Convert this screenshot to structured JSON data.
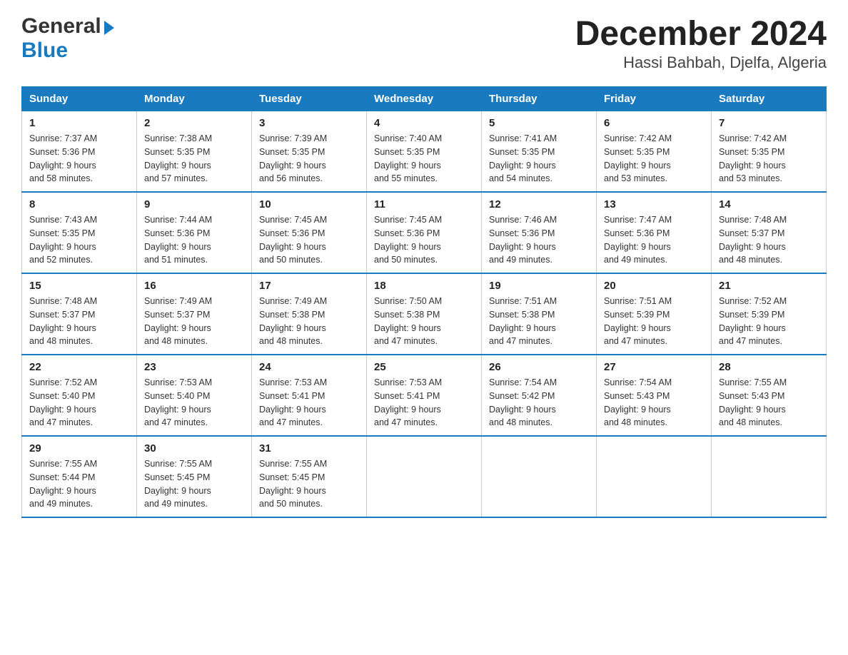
{
  "logo": {
    "line1": "General",
    "triangle": "▶",
    "line2": "Blue"
  },
  "title": "December 2024",
  "subtitle": "Hassi Bahbah, Djelfa, Algeria",
  "days_of_week": [
    "Sunday",
    "Monday",
    "Tuesday",
    "Wednesday",
    "Thursday",
    "Friday",
    "Saturday"
  ],
  "weeks": [
    [
      {
        "day": "1",
        "sunrise": "7:37 AM",
        "sunset": "5:36 PM",
        "daylight": "9 hours and 58 minutes."
      },
      {
        "day": "2",
        "sunrise": "7:38 AM",
        "sunset": "5:35 PM",
        "daylight": "9 hours and 57 minutes."
      },
      {
        "day": "3",
        "sunrise": "7:39 AM",
        "sunset": "5:35 PM",
        "daylight": "9 hours and 56 minutes."
      },
      {
        "day": "4",
        "sunrise": "7:40 AM",
        "sunset": "5:35 PM",
        "daylight": "9 hours and 55 minutes."
      },
      {
        "day": "5",
        "sunrise": "7:41 AM",
        "sunset": "5:35 PM",
        "daylight": "9 hours and 54 minutes."
      },
      {
        "day": "6",
        "sunrise": "7:42 AM",
        "sunset": "5:35 PM",
        "daylight": "9 hours and 53 minutes."
      },
      {
        "day": "7",
        "sunrise": "7:42 AM",
        "sunset": "5:35 PM",
        "daylight": "9 hours and 53 minutes."
      }
    ],
    [
      {
        "day": "8",
        "sunrise": "7:43 AM",
        "sunset": "5:35 PM",
        "daylight": "9 hours and 52 minutes."
      },
      {
        "day": "9",
        "sunrise": "7:44 AM",
        "sunset": "5:36 PM",
        "daylight": "9 hours and 51 minutes."
      },
      {
        "day": "10",
        "sunrise": "7:45 AM",
        "sunset": "5:36 PM",
        "daylight": "9 hours and 50 minutes."
      },
      {
        "day": "11",
        "sunrise": "7:45 AM",
        "sunset": "5:36 PM",
        "daylight": "9 hours and 50 minutes."
      },
      {
        "day": "12",
        "sunrise": "7:46 AM",
        "sunset": "5:36 PM",
        "daylight": "9 hours and 49 minutes."
      },
      {
        "day": "13",
        "sunrise": "7:47 AM",
        "sunset": "5:36 PM",
        "daylight": "9 hours and 49 minutes."
      },
      {
        "day": "14",
        "sunrise": "7:48 AM",
        "sunset": "5:37 PM",
        "daylight": "9 hours and 48 minutes."
      }
    ],
    [
      {
        "day": "15",
        "sunrise": "7:48 AM",
        "sunset": "5:37 PM",
        "daylight": "9 hours and 48 minutes."
      },
      {
        "day": "16",
        "sunrise": "7:49 AM",
        "sunset": "5:37 PM",
        "daylight": "9 hours and 48 minutes."
      },
      {
        "day": "17",
        "sunrise": "7:49 AM",
        "sunset": "5:38 PM",
        "daylight": "9 hours and 48 minutes."
      },
      {
        "day": "18",
        "sunrise": "7:50 AM",
        "sunset": "5:38 PM",
        "daylight": "9 hours and 47 minutes."
      },
      {
        "day": "19",
        "sunrise": "7:51 AM",
        "sunset": "5:38 PM",
        "daylight": "9 hours and 47 minutes."
      },
      {
        "day": "20",
        "sunrise": "7:51 AM",
        "sunset": "5:39 PM",
        "daylight": "9 hours and 47 minutes."
      },
      {
        "day": "21",
        "sunrise": "7:52 AM",
        "sunset": "5:39 PM",
        "daylight": "9 hours and 47 minutes."
      }
    ],
    [
      {
        "day": "22",
        "sunrise": "7:52 AM",
        "sunset": "5:40 PM",
        "daylight": "9 hours and 47 minutes."
      },
      {
        "day": "23",
        "sunrise": "7:53 AM",
        "sunset": "5:40 PM",
        "daylight": "9 hours and 47 minutes."
      },
      {
        "day": "24",
        "sunrise": "7:53 AM",
        "sunset": "5:41 PM",
        "daylight": "9 hours and 47 minutes."
      },
      {
        "day": "25",
        "sunrise": "7:53 AM",
        "sunset": "5:41 PM",
        "daylight": "9 hours and 47 minutes."
      },
      {
        "day": "26",
        "sunrise": "7:54 AM",
        "sunset": "5:42 PM",
        "daylight": "9 hours and 48 minutes."
      },
      {
        "day": "27",
        "sunrise": "7:54 AM",
        "sunset": "5:43 PM",
        "daylight": "9 hours and 48 minutes."
      },
      {
        "day": "28",
        "sunrise": "7:55 AM",
        "sunset": "5:43 PM",
        "daylight": "9 hours and 48 minutes."
      }
    ],
    [
      {
        "day": "29",
        "sunrise": "7:55 AM",
        "sunset": "5:44 PM",
        "daylight": "9 hours and 49 minutes."
      },
      {
        "day": "30",
        "sunrise": "7:55 AM",
        "sunset": "5:45 PM",
        "daylight": "9 hours and 49 minutes."
      },
      {
        "day": "31",
        "sunrise": "7:55 AM",
        "sunset": "5:45 PM",
        "daylight": "9 hours and 50 minutes."
      },
      null,
      null,
      null,
      null
    ]
  ],
  "labels": {
    "sunrise": "Sunrise:",
    "sunset": "Sunset:",
    "daylight": "Daylight:"
  }
}
